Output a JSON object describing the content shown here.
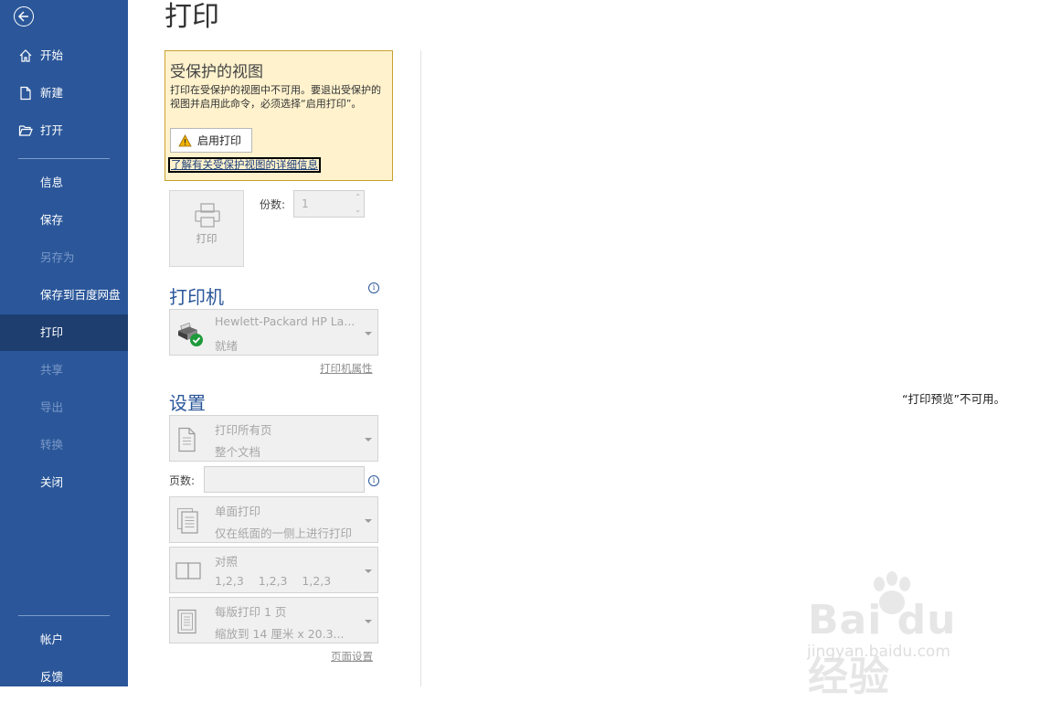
{
  "sidebar": {
    "items": [
      {
        "label": "开始",
        "icon": "home-icon",
        "state": "normal"
      },
      {
        "label": "新建",
        "icon": "new-document-icon",
        "state": "normal"
      },
      {
        "label": "打开",
        "icon": "folder-open-icon",
        "state": "normal"
      },
      {
        "label": "信息",
        "state": "normal"
      },
      {
        "label": "保存",
        "state": "normal"
      },
      {
        "label": "另存为",
        "state": "disabled"
      },
      {
        "label": "保存到百度网盘",
        "state": "normal"
      },
      {
        "label": "打印",
        "state": "active"
      },
      {
        "label": "共享",
        "state": "disabled"
      },
      {
        "label": "导出",
        "state": "disabled"
      },
      {
        "label": "转换",
        "state": "disabled"
      },
      {
        "label": "关闭",
        "state": "normal"
      },
      {
        "label": "帐户",
        "state": "normal"
      },
      {
        "label": "反馈",
        "state": "normal"
      }
    ],
    "colors": {
      "background": "#2b579a",
      "active": "#1e3e70",
      "disabled_text": "#7b99c8"
    }
  },
  "page": {
    "title": "打印"
  },
  "protected_view": {
    "title": "受保护的视图",
    "description": "打印在受保护的视图中不可用。要退出受保护的视图并启用此命令，必须选择“启用打印”。",
    "enable_button": "启用打印",
    "learn_more": "了解有关受保护视图的详细信息",
    "background": "#fff2cd"
  },
  "print_button": {
    "label": "打印"
  },
  "copies": {
    "label": "份数:",
    "value": "1"
  },
  "printer": {
    "section_title": "打印机",
    "name": "Hewlett-Packard HP La...",
    "status": "就绪",
    "properties_link": "打印机属性"
  },
  "settings": {
    "section_title": "设置",
    "print_range": {
      "line1": "打印所有页",
      "line2": "整个文档"
    },
    "pages_label": "页数:",
    "pages_value": "",
    "sides": {
      "line1": "单面打印",
      "line2": "仅在纸面的一侧上进行打印"
    },
    "collation": {
      "line1": "对照",
      "line2": "1,2,3    1,2,3    1,2,3"
    },
    "per_sheet": {
      "line1": "每版打印 1 页",
      "line2": "缩放到 14 厘米 x 20.3..."
    },
    "page_setup_link": "页面设置"
  },
  "preview": {
    "message": "“打印预览”不可用。"
  },
  "watermark": {
    "main": "Bai du 经验",
    "sub": "jingyan.baidu.com"
  }
}
